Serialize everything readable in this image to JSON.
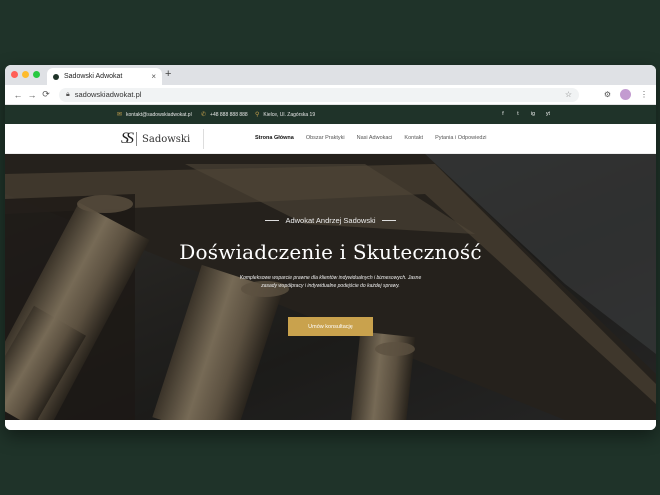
{
  "browser": {
    "tab_title": "Sadowski Adwokat",
    "tab_close": "×",
    "new_tab": "+",
    "url": "sadowskiadwokat.pl"
  },
  "infobar": {
    "email": "kontakt@sadowskiadwokat.pl",
    "phone": "+48 888 888 888",
    "address": "Kielce, Ul. Zagórska 19",
    "socials": [
      "f",
      "t",
      "ig",
      "yt"
    ]
  },
  "site": {
    "logo_mark": "SS",
    "logo_text": "Sadowski",
    "menu": [
      "Strona Główna",
      "Obszar Praktyki",
      "Nasi Adwokaci",
      "Kontakt",
      "Pytania i Odpowiedzi"
    ]
  },
  "hero": {
    "eyebrow": "Adwokat Andrzej Sadowski",
    "headline": "Doświadczenie i Skuteczność",
    "sub_line1": "Kompleksowe wsparcie prawne dla klientów indywidualnych i biznesowych. Jasne",
    "sub_line2": "zasady współpracy i indywidualne podejście do każdej sprawy.",
    "cta": "Umów konsultację"
  },
  "colors": {
    "brand_dark": "#1f3329",
    "accent_gold": "#c9a24d"
  },
  "icons": {
    "email": "mail-icon",
    "phone": "phone-icon",
    "location": "location-pin-icon"
  }
}
